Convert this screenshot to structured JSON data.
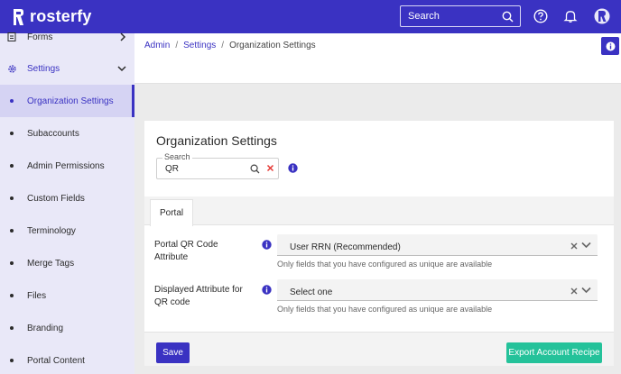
{
  "app": {
    "brand": "rosterfy"
  },
  "header": {
    "search_placeholder": "Search",
    "icons": [
      "search-icon",
      "help-icon",
      "bell-icon",
      "profile-icon"
    ],
    "color": "#3a32c2"
  },
  "sidebar": {
    "forms_label": "Forms",
    "settings_label": "Settings",
    "items": [
      {
        "label": "Organization Settings",
        "active": true
      },
      {
        "label": "Subaccounts"
      },
      {
        "label": "Admin Permissions"
      },
      {
        "label": "Custom Fields"
      },
      {
        "label": "Terminology"
      },
      {
        "label": "Merge Tags"
      },
      {
        "label": "Files"
      },
      {
        "label": "Branding"
      },
      {
        "label": "Portal Content"
      }
    ]
  },
  "breadcrumb": {
    "admin": "Admin",
    "settings": "Settings",
    "current": "Organization Settings",
    "separator": "/"
  },
  "card": {
    "title": "Organization Settings",
    "search": {
      "legend": "Search",
      "value": "QR"
    },
    "tab": "Portal",
    "fields": [
      {
        "label": "Portal QR Code Attribute",
        "value": "User RRN (Recommended)",
        "helper": "Only fields that you have configured as unique are available"
      },
      {
        "label": "Displayed Attribute for QR code",
        "value": "Select one",
        "helper": "Only fields that you have configured as unique are available"
      }
    ],
    "save_label": "Save",
    "export_label": "Export Account Recipe"
  },
  "colors": {
    "accent": "#3a32c2",
    "export": "#24c29a",
    "danger": "#e53935"
  }
}
